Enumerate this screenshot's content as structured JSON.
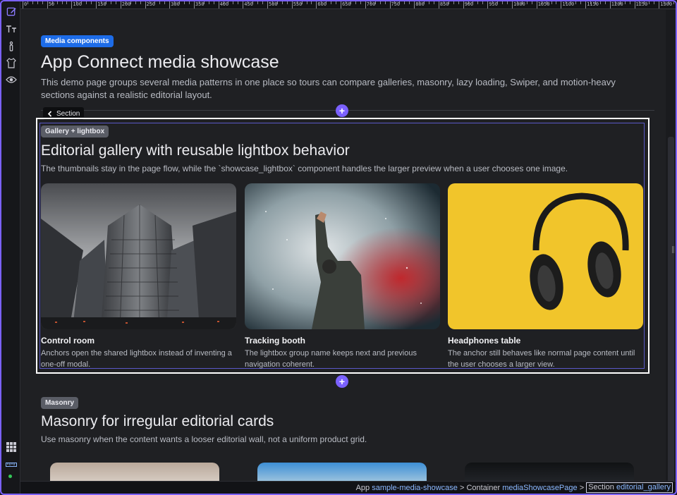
{
  "tools": [
    {
      "icon": "edit-icon",
      "glyph": "✎"
    },
    {
      "icon": "text-size-icon",
      "glyph": "тT"
    },
    {
      "icon": "info-icon",
      "glyph": "ℹ"
    },
    {
      "icon": "shirt-icon",
      "glyph": "👕"
    },
    {
      "icon": "eye-icon",
      "glyph": "👁"
    },
    {
      "icon": "grid-icon",
      "glyph": "▦"
    },
    {
      "icon": "ruler-icon",
      "glyph": "📏"
    }
  ],
  "ruler": [
    "0",
    "50",
    "100",
    "150",
    "200",
    "250",
    "300",
    "350",
    "400",
    "450",
    "500",
    "550",
    "600",
    "650",
    "700",
    "750",
    "800",
    "850",
    "900",
    "950",
    "1000",
    "1050",
    "1100",
    "1150",
    "1200",
    "1250",
    "1300"
  ],
  "hero": {
    "badge": "Media components",
    "title": "App Connect media showcase",
    "description": "This demo page groups several media patterns in one place so tours can compare galleries, masonry, lazy loading, Swiper, and motion-heavy sections against a realistic editorial layout."
  },
  "section_tab": {
    "label": "Section"
  },
  "gallery": {
    "badge": "Gallery + lightbox",
    "title": "Editorial gallery with reusable lightbox behavior",
    "description": "The thumbnails stay in the page flow, while the `showcase_lightbox` component handles the larger preview when a user chooses one image.",
    "cards": [
      {
        "title": "Control room",
        "text": "Anchors open the shared lightbox instead of inventing a one-off modal.",
        "image": "skyscrapers-photo"
      },
      {
        "title": "Tracking booth",
        "text": "The lightbox group name keeps next and previous navigation coherent.",
        "image": "concert-person-photo"
      },
      {
        "title": "Headphones table",
        "text": "The anchor still behaves like normal page content until the user chooses a larger view.",
        "image": "headphones-photo"
      }
    ]
  },
  "masonry": {
    "badge": "Masonry",
    "title": "Masonry for irregular editorial cards",
    "description": "Use masonry when the content wants a looser editorial wall, not a uniform product grid."
  },
  "breadcrumb": {
    "app_label": "App",
    "app_value": "sample-media-showcase",
    "container_label": "Container",
    "container_value": "mediaShowcasePage",
    "section_label": "Section",
    "section_value": "editorial_gallery",
    "separator": ">"
  },
  "colors": {
    "accent": "#7b61ff",
    "badge_blue": "#1d6ce8",
    "badge_gray": "#5a5d66",
    "link": "#8bb8ff"
  }
}
